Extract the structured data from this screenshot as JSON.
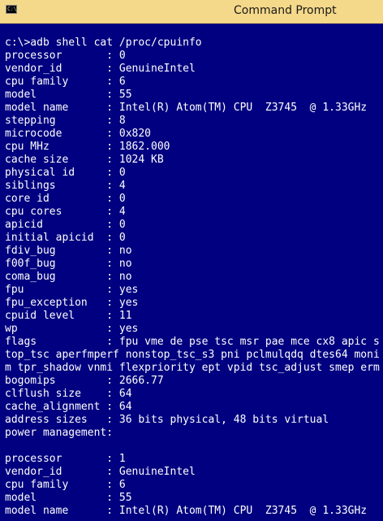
{
  "window": {
    "title": "Command Prompt",
    "icon_glyph": "C:\\",
    "icon_name": "console-icon"
  },
  "console": {
    "lines": [
      "c:\\>adb shell cat /proc/cpuinfo",
      "processor       : 0",
      "vendor_id       : GenuineIntel",
      "cpu family      : 6",
      "model           : 55",
      "model name      : Intel(R) Atom(TM) CPU  Z3745  @ 1.33GHz",
      "stepping        : 8",
      "microcode       : 0x820",
      "cpu MHz         : 1862.000",
      "cache size      : 1024 KB",
      "physical id     : 0",
      "siblings        : 4",
      "core id         : 0",
      "cpu cores       : 4",
      "apicid          : 0",
      "initial apicid  : 0",
      "fdiv_bug        : no",
      "f00f_bug        : no",
      "coma_bug        : no",
      "fpu             : yes",
      "fpu_exception   : yes",
      "cpuid level     : 11",
      "wp              : yes",
      "flags           : fpu vme de pse tsc msr pae mce cx8 apic s",
      "top_tsc aperfmperf nonstop_tsc_s3 pni pclmulqdq dtes64 moni",
      "m tpr_shadow vnmi flexpriority ept vpid tsc_adjust smep erm",
      "bogomips        : 2666.77",
      "clflush size    : 64",
      "cache_alignment : 64",
      "address sizes   : 36 bits physical, 48 bits virtual",
      "power management:",
      "",
      "processor       : 1",
      "vendor_id       : GenuineIntel",
      "cpu family      : 6",
      "model           : 55",
      "model name      : Intel(R) Atom(TM) CPU  Z3745  @ 1.33GHz"
    ]
  },
  "colors": {
    "console_background": "#000080",
    "console_text": "#ffffff",
    "titlebar_background": "#f5d98a"
  }
}
